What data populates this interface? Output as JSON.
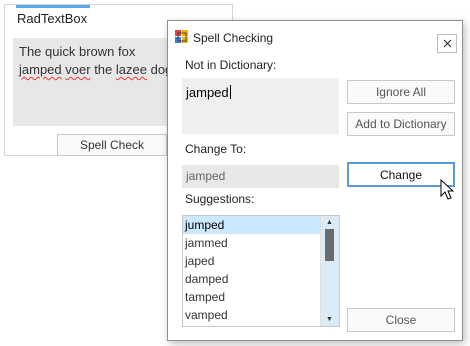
{
  "background": {
    "title": "RadTextBox",
    "textbox_line1": "The quick brown fox",
    "textbox_line2_word1": "jamped",
    "textbox_line2_word2": "voer",
    "textbox_line2_word3": "the",
    "textbox_line2_word4": "lazee",
    "textbox_line2_word5": "dog",
    "spell_check_button": "Spell Check"
  },
  "dialog": {
    "title": "Spell Checking",
    "icon": "spellcheck-app-icon",
    "close_icon": "close-icon",
    "not_in_dictionary_label": "Not in Dictionary:",
    "not_in_dictionary_value": "jamped",
    "ignore_all_button": "Ignore All",
    "add_to_dictionary_button": "Add to Dictionary",
    "change_to_label": "Change To:",
    "change_to_value": "jamped",
    "change_button": "Change",
    "suggestions_label": "Suggestions:",
    "suggestions": [
      "jumped",
      "jammed",
      "japed",
      "damped",
      "tamped",
      "vamped"
    ],
    "selected_suggestion": "jumped",
    "close_button": "Close"
  },
  "colors": {
    "accent": "#5aa9e6",
    "selection": "#cce8ff",
    "focus_border": "#5b9bd5",
    "misspelling_underline": "#e53935"
  }
}
